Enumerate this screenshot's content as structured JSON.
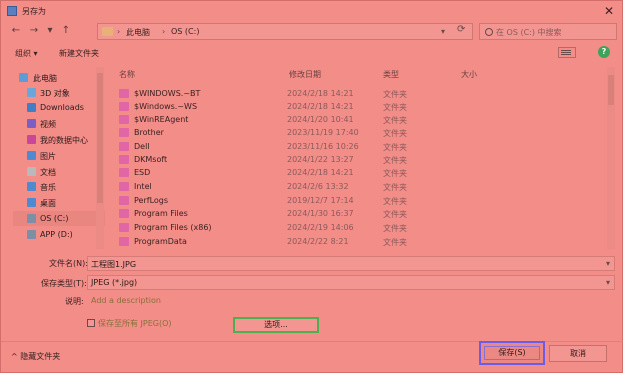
{
  "window": {
    "title": "另存为"
  },
  "address": {
    "crumbs": [
      "此电脑",
      "OS (C:)"
    ],
    "search_placeholder": "在 OS (C:) 中搜索"
  },
  "toolbar": {
    "organize": "组织 ▾",
    "new_folder": "新建文件夹"
  },
  "nav": {
    "items": [
      {
        "label": "此电脑",
        "icon": "pc-icon",
        "color": "#5f9bd6"
      },
      {
        "label": "3D 对象",
        "icon": "3d-objects-icon",
        "color": "#6aa6d8"
      },
      {
        "label": "Downloads",
        "icon": "downloads-icon",
        "color": "#3f7fc6"
      },
      {
        "label": "视频",
        "icon": "video-icon",
        "color": "#7b5fc4"
      },
      {
        "label": "我的数据中心",
        "icon": "data-center-icon",
        "color": "#c8479a"
      },
      {
        "label": "图片",
        "icon": "pictures-icon",
        "color": "#4f8ad0"
      },
      {
        "label": "文档",
        "icon": "documents-icon",
        "color": "#b9b9b9"
      },
      {
        "label": "音乐",
        "icon": "music-icon",
        "color": "#4f8ad0"
      },
      {
        "label": "桌面",
        "icon": "desktop-icon",
        "color": "#4f8ad0"
      },
      {
        "label": "OS (C:)",
        "icon": "drive-icon",
        "color": "#7d8ea6"
      },
      {
        "label": "APP (D:)",
        "icon": "drive-icon",
        "color": "#7d8ea6"
      }
    ]
  },
  "filelist": {
    "columns": [
      "名称",
      "修改日期",
      "类型",
      "大小"
    ],
    "rows": [
      {
        "name": "$WINDOWS.~BT",
        "date": "2024/2/18 14:21",
        "type": "文件夹"
      },
      {
        "name": "$Windows.~WS",
        "date": "2024/2/18 14:21",
        "type": "文件夹"
      },
      {
        "name": "$WinREAgent",
        "date": "2024/1/20 10:41",
        "type": "文件夹"
      },
      {
        "name": "Brother",
        "date": "2023/11/19 17:40",
        "type": "文件夹"
      },
      {
        "name": "Dell",
        "date": "2023/11/16 10:26",
        "type": "文件夹"
      },
      {
        "name": "DKMsoft",
        "date": "2024/1/22 13:27",
        "type": "文件夹"
      },
      {
        "name": "ESD",
        "date": "2024/2/18 14:21",
        "type": "文件夹"
      },
      {
        "name": "Intel",
        "date": "2024/2/6 13:32",
        "type": "文件夹"
      },
      {
        "name": "PerfLogs",
        "date": "2019/12/7 17:14",
        "type": "文件夹"
      },
      {
        "name": "Program Files",
        "date": "2024/1/30 16:37",
        "type": "文件夹"
      },
      {
        "name": "Program Files (x86)",
        "date": "2024/2/19 14:06",
        "type": "文件夹"
      },
      {
        "name": "ProgramData",
        "date": "2024/2/22 8:21",
        "type": "文件夹"
      }
    ]
  },
  "form": {
    "filename_label": "文件名(N):",
    "filename_value": "工程图1.JPG",
    "filetype_label": "保存类型(T):",
    "filetype_value": "JPEG (*.jpg)",
    "description_label": "说明:",
    "description_link": "Add a description",
    "checkbox_label": "保存至所有 JPEG(O)",
    "options_button": "选项..."
  },
  "footer": {
    "hide_folders": "^ 隐藏文件夹",
    "save_button": "保存(S)",
    "cancel_button": "取消"
  },
  "colors": {
    "accent_save_border": "#6c5ce7",
    "options_border": "#4caf50",
    "folder_icon": "#e066a6"
  }
}
